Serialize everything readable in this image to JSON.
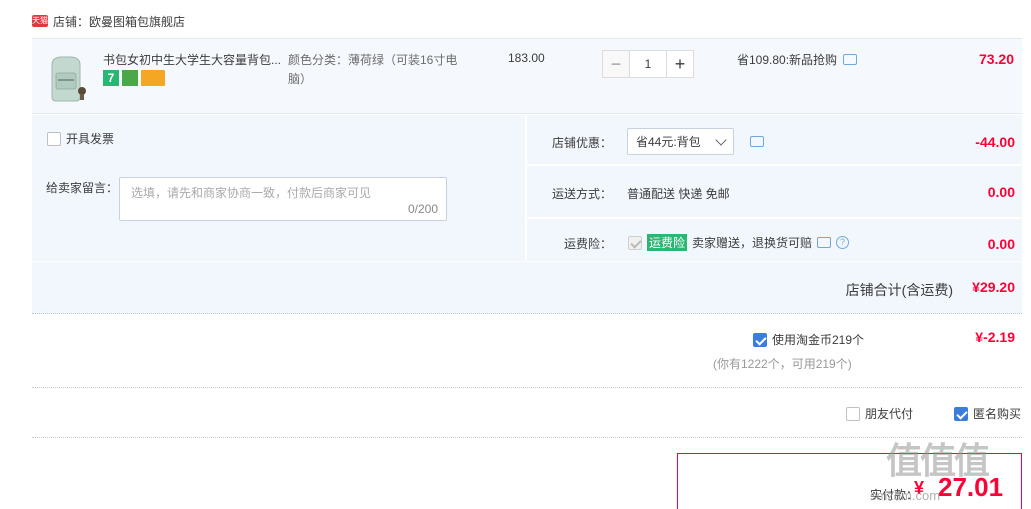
{
  "shop": {
    "badge": "天猫",
    "label": "店铺：欧曼图箱包旗舰店"
  },
  "item": {
    "title": "书包女初中生大学生大容量背包...",
    "badge_seven": "7",
    "sku": "颜色分类：薄荷绿（可装16寸电脑）",
    "price": "183.00",
    "qty_minus": "−",
    "qty": "1",
    "qty_plus": "+",
    "discount": "省109.80:新品抢购",
    "subtotal": "73.20"
  },
  "options": {
    "invoice": "开具发票",
    "memo_label": "给卖家留言：",
    "memo_placeholder": "选填，请先和商家协商一致，付款后商家可见",
    "memo_count": "0/200",
    "shop_discount_label": "店铺优惠：",
    "shop_discount_select": "省44元:背包",
    "shop_discount_value": "-44.00",
    "shipping_label": "运送方式：",
    "shipping_text": "普通配送 快递 免邮",
    "shipping_value": "0.00",
    "insurance_label": "运费险：",
    "insurance_tag": "运费险",
    "insurance_text": "卖家赠送，退换货可赔",
    "insurance_help": "?",
    "insurance_value": "0.00"
  },
  "totals": {
    "shop_total_label": "店铺合计(含运费)",
    "shop_total_value": "¥29.20",
    "coin_label": "使用淘金币219个",
    "coin_value": "¥-2.19",
    "coin_note": "(你有1222个，可用219个)",
    "friend_pay": "朋友代付",
    "anonymous": "匿名购买",
    "pay_label": "实付款：",
    "pay_symbol": "¥",
    "pay_amount": "27.01"
  },
  "watermark": {
    "logo": "值值值",
    "url": "smzdm.com"
  },
  "colors": {
    "accent_red": "#ff0036",
    "checkbox_blue": "#3b7ddd",
    "panel_bg": "#f2f7fd",
    "tag_green": "#2bb673"
  }
}
